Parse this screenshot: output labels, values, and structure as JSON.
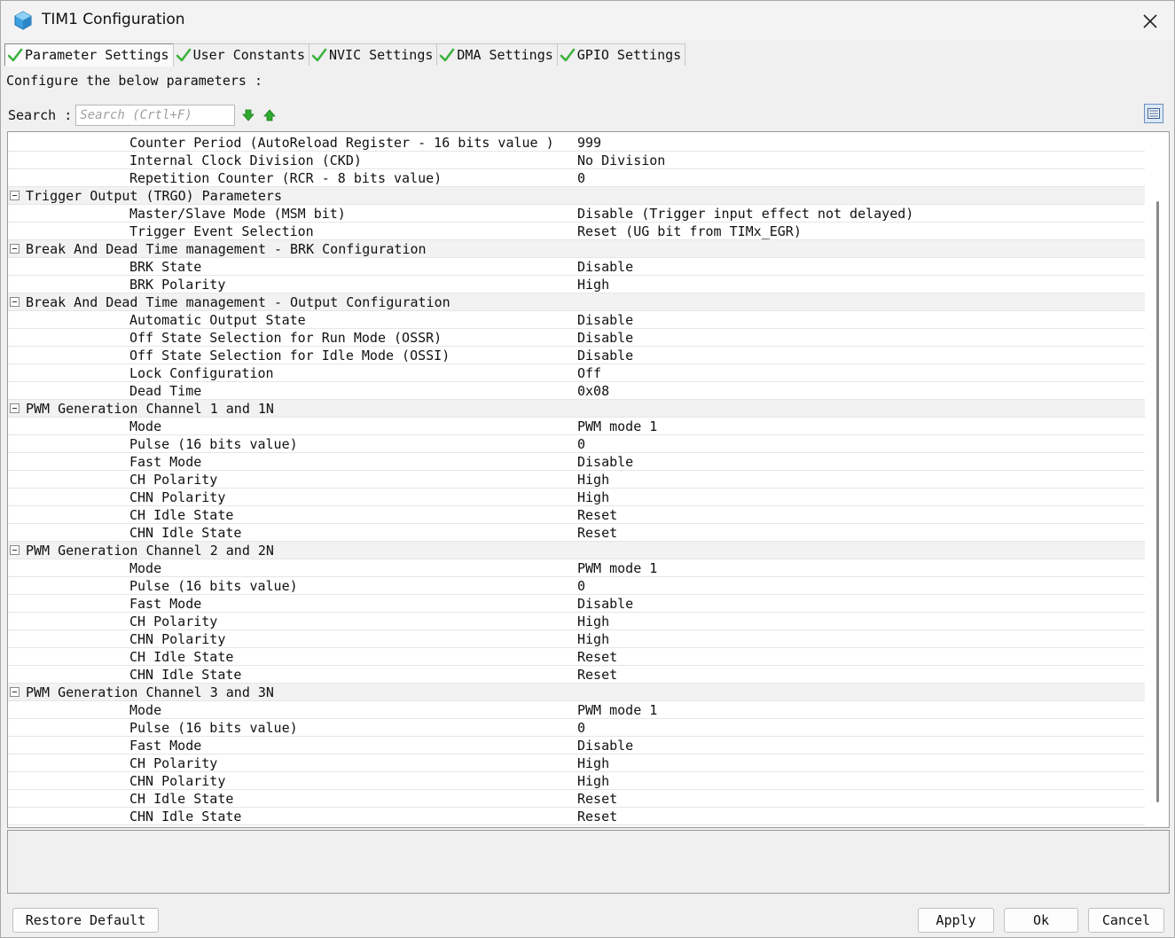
{
  "window": {
    "title": "TIM1 Configuration"
  },
  "tabs": [
    {
      "label": "Parameter Settings"
    },
    {
      "label": "User Constants"
    },
    {
      "label": "NVIC Settings"
    },
    {
      "label": "DMA Settings"
    },
    {
      "label": "GPIO Settings"
    }
  ],
  "hint": "Configure the below parameters :",
  "search": {
    "label": "Search :",
    "placeholder": "Search (Crtl+F)"
  },
  "params": [
    {
      "type": "param",
      "name": "Counter Period (AutoReload Register - 16 bits value )",
      "value": "999"
    },
    {
      "type": "param",
      "name": "Internal Clock Division (CKD)",
      "value": "No Division"
    },
    {
      "type": "param",
      "name": "Repetition Counter (RCR - 8 bits value)",
      "value": "0"
    },
    {
      "type": "group",
      "name": "Trigger Output (TRGO) Parameters"
    },
    {
      "type": "param",
      "name": "Master/Slave Mode (MSM bit)",
      "value": "Disable (Trigger input effect not delayed)"
    },
    {
      "type": "param",
      "name": "Trigger Event Selection",
      "value": "Reset (UG bit from TIMx_EGR)"
    },
    {
      "type": "group",
      "name": "Break And Dead Time management - BRK Configuration"
    },
    {
      "type": "param",
      "name": "BRK State",
      "value": "Disable"
    },
    {
      "type": "param",
      "name": "BRK Polarity",
      "value": "High"
    },
    {
      "type": "group",
      "name": "Break And Dead Time management - Output Configuration"
    },
    {
      "type": "param",
      "name": "Automatic Output State",
      "value": "Disable"
    },
    {
      "type": "param",
      "name": "Off State Selection for Run Mode (OSSR)",
      "value": "Disable"
    },
    {
      "type": "param",
      "name": "Off State Selection for Idle Mode (OSSI)",
      "value": "Disable"
    },
    {
      "type": "param",
      "name": "Lock Configuration",
      "value": "Off"
    },
    {
      "type": "param",
      "name": "Dead Time",
      "value": "0x08"
    },
    {
      "type": "group",
      "name": "PWM Generation Channel 1 and 1N"
    },
    {
      "type": "param",
      "name": "Mode",
      "value": "PWM mode 1"
    },
    {
      "type": "param",
      "name": "Pulse (16 bits value)",
      "value": "0"
    },
    {
      "type": "param",
      "name": "Fast Mode",
      "value": "Disable"
    },
    {
      "type": "param",
      "name": "CH Polarity",
      "value": "High"
    },
    {
      "type": "param",
      "name": "CHN Polarity",
      "value": "High"
    },
    {
      "type": "param",
      "name": "CH Idle State",
      "value": "Reset"
    },
    {
      "type": "param",
      "name": "CHN Idle State",
      "value": "Reset"
    },
    {
      "type": "group",
      "name": "PWM Generation Channel 2 and 2N"
    },
    {
      "type": "param",
      "name": "Mode",
      "value": "PWM mode 1"
    },
    {
      "type": "param",
      "name": "Pulse (16 bits value)",
      "value": "0"
    },
    {
      "type": "param",
      "name": "Fast Mode",
      "value": "Disable"
    },
    {
      "type": "param",
      "name": "CH Polarity",
      "value": "High"
    },
    {
      "type": "param",
      "name": "CHN Polarity",
      "value": "High"
    },
    {
      "type": "param",
      "name": "CH Idle State",
      "value": "Reset"
    },
    {
      "type": "param",
      "name": "CHN Idle State",
      "value": "Reset"
    },
    {
      "type": "group",
      "name": "PWM Generation Channel 3 and 3N"
    },
    {
      "type": "param",
      "name": "Mode",
      "value": "PWM mode 1"
    },
    {
      "type": "param",
      "name": "Pulse (16 bits value)",
      "value": "0"
    },
    {
      "type": "param",
      "name": "Fast Mode",
      "value": "Disable"
    },
    {
      "type": "param",
      "name": "CH Polarity",
      "value": "High"
    },
    {
      "type": "param",
      "name": "CHN Polarity",
      "value": "High"
    },
    {
      "type": "param",
      "name": "CH Idle State",
      "value": "Reset"
    },
    {
      "type": "param",
      "name": "CHN Idle State",
      "value": "Reset"
    }
  ],
  "buttons": {
    "restore": "Restore Default",
    "apply": "Apply",
    "ok": "Ok",
    "cancel": "Cancel"
  },
  "colors": {
    "check": "#3db23d",
    "arrow": "#2fa82f"
  },
  "icons": {
    "app": "cube-icon",
    "close": "close-icon",
    "tab": "checkmark-icon",
    "next": "arrow-down-icon",
    "prev": "arrow-up-icon",
    "view": "list-view-icon",
    "group": "collapse-minus-icon"
  }
}
